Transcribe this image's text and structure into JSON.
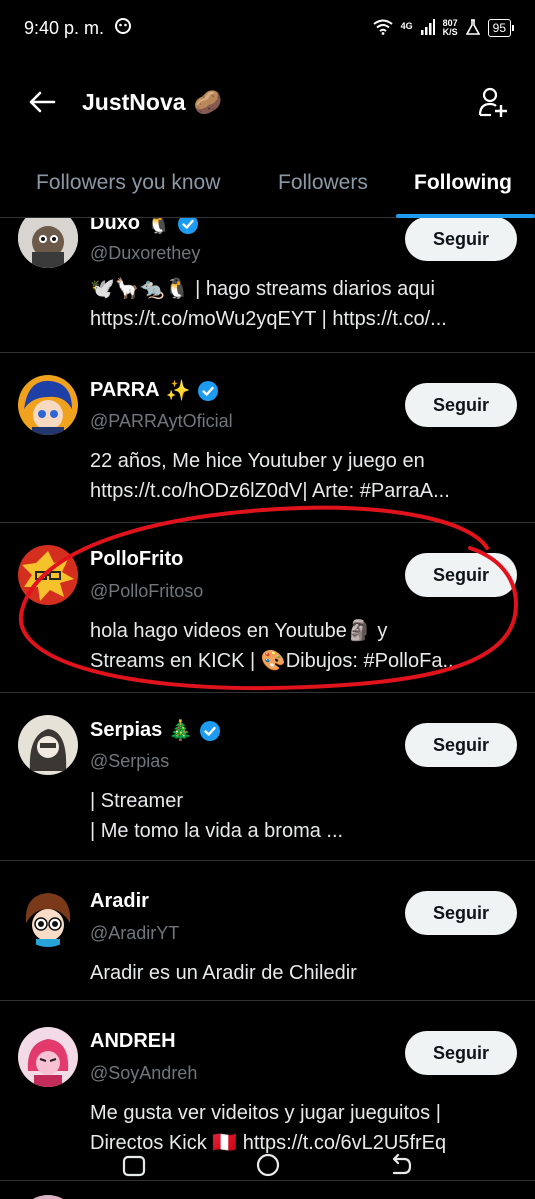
{
  "status_bar": {
    "time": "9:40 p. m.",
    "network": "4G",
    "speed_value": "807",
    "speed_unit": "K/S",
    "battery": "95"
  },
  "header": {
    "title": "JustNova",
    "emoji": "🥔"
  },
  "tabs": [
    {
      "label": "Followers you know"
    },
    {
      "label": "Followers"
    },
    {
      "label": "Following"
    }
  ],
  "follow_label": "Seguir",
  "users": [
    {
      "name": "Duxo",
      "name_emoji": "🐧",
      "verified": true,
      "handle": "@Duxorethey",
      "bio_lines": [
        "🕊️🦙🐀🐧 | hago streams diarios aqui",
        "https://t.co/moWu2yqEYT | https://t.co/..."
      ]
    },
    {
      "name": "PARRA",
      "name_emoji": "✨",
      "verified": true,
      "handle": "@PARRAytOficial",
      "bio_lines": [
        "22 años, Me hice Youtuber y juego en",
        "https://t.co/hODz6lZ0dV| Arte: #ParraA..."
      ]
    },
    {
      "name": "PolloFrito",
      "name_emoji": "",
      "verified": false,
      "handle": "@PolloFritoso",
      "bio_lines": [
        "hola hago videos en Youtube🗿 y",
        "Streams en KICK | 🎨Dibujos: #PolloFa..."
      ]
    },
    {
      "name": "Serpias",
      "name_emoji": "🎄",
      "verified": true,
      "handle": "@Serpias",
      "bio_lines": [
        "| Streamer",
        "| Me tomo la vida a broma ..."
      ]
    },
    {
      "name": "Aradir",
      "name_emoji": "",
      "verified": false,
      "handle": "@AradirYT",
      "bio_lines": [
        "Aradir es un Aradir de Chiledir"
      ]
    },
    {
      "name": "ANDREH",
      "name_emoji": "",
      "verified": false,
      "handle": "@SoyAndreh",
      "bio_lines": [
        "Me gusta ver videitos y jugar jueguitos |",
        "Directos Kick 🇵🇪 https://t.co/6vL2U5frEq"
      ]
    }
  ],
  "colors": {
    "background": "#000000",
    "accent": "#1d9bf0",
    "annotation": "#e0121b",
    "button_bg": "#eff3f4"
  }
}
